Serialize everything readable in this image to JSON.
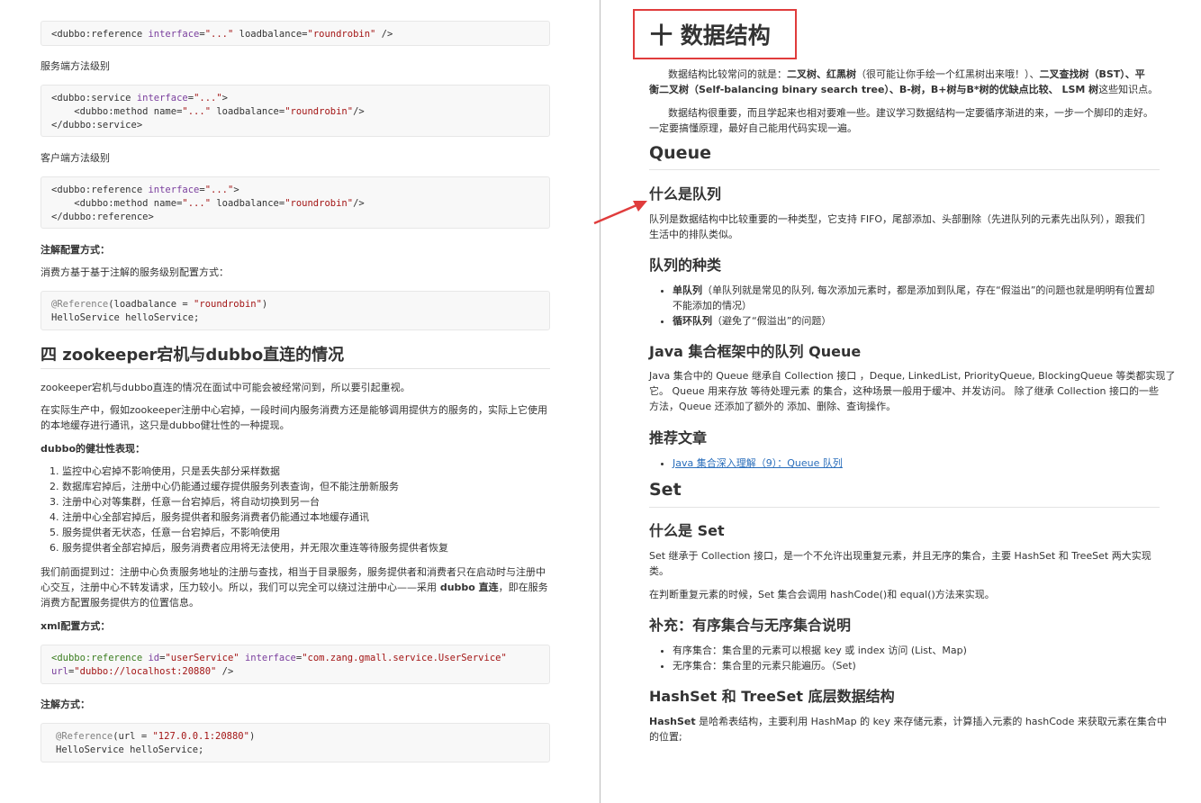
{
  "left": {
    "code1": {
      "line1_a": "<dubbo:reference ",
      "line1_attr": "interface",
      "line1_b": "=",
      "line1_str": "\"...\"",
      "line1_c": " loadbalance=",
      "line1_str2": "\"roundrobin\"",
      "line1_d": " />"
    },
    "label_server_method": "服务端方法级别",
    "code2": {
      "l1a": "<dubbo:service ",
      "l1attr": "interface",
      "l1b": "=",
      "l1str": "\"...\"",
      "l1c": ">",
      "l2a": "    <dubbo:method name=",
      "l2str": "\"...\"",
      "l2b": " loadbalance=",
      "l2str2": "\"roundrobin\"",
      "l2c": "/>",
      "l3": "</dubbo:service>"
    },
    "label_client_method": "客户端方法级别",
    "code3": {
      "l1a": "<dubbo:reference ",
      "l1attr": "interface",
      "l1b": "=",
      "l1str": "\"...\"",
      "l1c": ">",
      "l2a": "    <dubbo:method name=",
      "l2str": "\"...\"",
      "l2b": " loadbalance=",
      "l2str2": "\"roundrobin\"",
      "l2c": "/>",
      "l3": "</dubbo:reference>"
    },
    "anno_config_title": "注解配置方式：",
    "anno_config_desc": "消费方基于基于注解的服务级别配置方式：",
    "code4": {
      "l1a": "@Reference",
      "l1b": "(loadbalance = ",
      "l1str": "\"roundrobin\"",
      "l1c": ")",
      "l2": "HelloService helloService;"
    },
    "section4_title": "四 zookeeper宕机与dubbo直连的情况",
    "p_intro": "zookeeper宕机与dubbo直连的情况在面试中可能会被经常问到，所以要引起重视。",
    "p_prod_1": "在实际生产中，假如zookeeper注册中心宕掉，一段时间内服务消费方还是能够调用提供方的服务的，实际上它使用",
    "p_prod_2": "的本地缓存进行通讯，这只是dubbo健壮性的一种提现。",
    "robust_title": "dubbo的健壮性表现：",
    "robust_items": [
      "监控中心宕掉不影响使用，只是丢失部分采样数据",
      "数据库宕掉后，注册中心仍能通过缓存提供服务列表查询，但不能注册新服务",
      "注册中心对等集群，任意一台宕掉后，将自动切换到另一台",
      "注册中心全部宕掉后，服务提供者和服务消费者仍能通过本地缓存通讯",
      "服务提供者无状态，任意一台宕掉后，不影响使用",
      "服务提供者全部宕掉后，服务消费者应用将无法使用，并无限次重连等待服务提供者恢复"
    ],
    "p_direct_1": "我们前面提到过：注册中心负责服务地址的注册与查找，相当于目录服务，服务提供者和消费者只在启动时与注册中",
    "p_direct_2": "心交互，注册中心不转发请求，压力较小。所以，我们可以完全可以绕过注册中心——采用",
    "p_direct_bold": " dubbo 直连",
    "p_direct_2b": "，即在服务",
    "p_direct_3": "消费方配置服务提供方的位置信息。",
    "xml_title": "xml配置方式：",
    "code5": {
      "l1a": "<dubbo:reference ",
      "l1attr": "id",
      "l1b": "=",
      "l1str": "\"userService\"",
      "l1c": " ",
      "l1attr2": "interface",
      "l1d": "=",
      "l1str2": "\"com.zang.gmall.service.UserService\"",
      "l2attr": "url",
      "l2b": "=",
      "l2str": "\"dubbo://localhost:20880\"",
      "l2c": " />"
    },
    "anno_title": "注解方式：",
    "code6": {
      "l1a": "@Reference",
      "l1b": "(url = ",
      "l1str": "\"127.0.0.1:20880\"",
      "l1c": ")",
      "l2": "HelloService helloService;"
    }
  },
  "right": {
    "chapter_title": "十 数据结构",
    "intro_1a": "数据结构比较常问的就是：",
    "intro_1b": "二叉树、红黑树",
    "intro_1c": "（很可能让你手绘一个红黑树出来哦！）、",
    "intro_1d": "二叉查找树（BST）、平",
    "intro_2a": "衡二叉树（Self-balancing binary search tree）、B-树，B+树与B*树的优缺点比较、 LSM 树",
    "intro_2b": "这些知识点。",
    "intro_3": "数据结构很重要，而且学起来也相对要难一些。建议学习数据结构一定要循序渐进的来，一步一个脚印的走好。",
    "intro_4": "一定要搞懂原理，最好自己能用代码实现一遍。",
    "queue_title": "Queue",
    "what_queue_title": "什么是队列",
    "what_queue_1": "队列是数据结构中比较重要的一种类型，它支持 FIFO，尾部添加、头部删除（先进队列的元素先出队列），跟我们",
    "what_queue_2": "生活中的排队类似。",
    "queue_kinds_title": "队列的种类",
    "queue_kinds": [
      {
        "bold": "单队列",
        "text": "（单队列就是常见的队列, 每次添加元素时，都是添加到队尾，存在“假溢出”的问题也就是明明有位置却",
        "text2": "不能添加的情况）"
      },
      {
        "bold": "循环队列",
        "text": "（避免了“假溢出”的问题）",
        "text2": ""
      }
    ],
    "java_queue_title": "Java 集合框架中的队列 Queue",
    "java_queue_1": "Java 集合中的 Queue 继承自 Collection 接口 ，Deque, LinkedList, PriorityQueue, BlockingQueue 等类都实现了",
    "java_queue_2": "它。 Queue 用来存放 等待处理元素 的集合，这种场景一般用于缓冲、并发访问。 除了继承 Collection 接口的一些",
    "java_queue_3": "方法，Queue 还添加了额外的 添加、删除、查询操作。",
    "recommend_title": "推荐文章",
    "recommend_link": "Java 集合深入理解（9）：Queue 队列",
    "set_title": "Set",
    "what_set_title": "什么是 Set",
    "what_set_1": "Set 继承于 Collection 接口，是一个不允许出现重复元素，并且无序的集合，主要 HashSet 和 TreeSet 两大实现",
    "what_set_2": "类。",
    "set_hash_desc": "在判断重复元素的时候，Set 集合会调用 hashCode()和 equal()方法来实现。",
    "supplement_title": "补充：有序集合与无序集合说明",
    "supplement_items": [
      "有序集合：集合里的元素可以根据 key 或 index 访问 (List、Map)",
      "无序集合：集合里的元素只能遍历。（Set)"
    ],
    "hashset_title": "HashSet 和 TreeSet 底层数据结构",
    "hashset_bold": "HashSet",
    "hashset_1": " 是哈希表结构，主要利用 HashMap 的 key 来存储元素，计算插入元素的 hashCode 来获取元素在集合中",
    "hashset_2": "的位置;"
  },
  "colors": {
    "annotation_box": "#e03c3c",
    "arrow": "#e03c3c",
    "link": "#2a6ebb"
  }
}
